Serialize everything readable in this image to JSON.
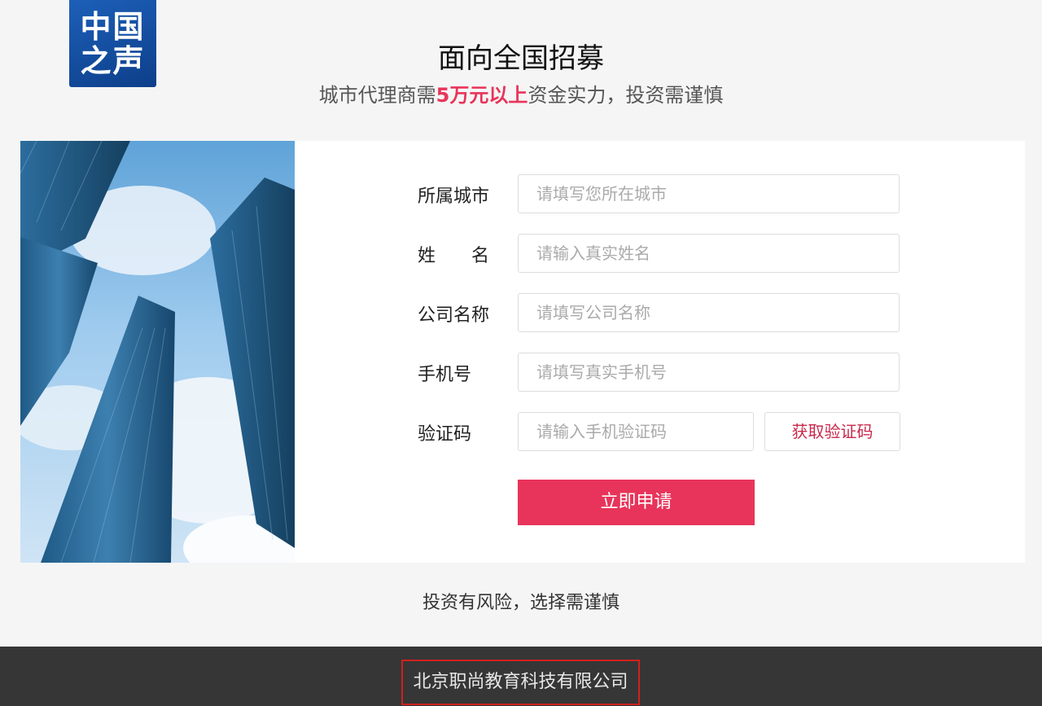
{
  "logo": {
    "line1": "中国",
    "line2": "之声"
  },
  "header": {
    "title": "面向全国招募",
    "subtitle_before": "城市代理商需",
    "subtitle_highlight": "5万元以上",
    "subtitle_after": "资金实力，投资需谨慎"
  },
  "form": {
    "city": {
      "label": "所属城市",
      "placeholder": "请填写您所在城市"
    },
    "name": {
      "label": "姓　　名",
      "placeholder": "请输入真实姓名"
    },
    "company": {
      "label": "公司名称",
      "placeholder": "请填写公司名称"
    },
    "phone": {
      "label": "手机号",
      "placeholder": "请填写真实手机号"
    },
    "code": {
      "label": "验证码",
      "placeholder": "请输入手机验证码",
      "button": "获取验证码"
    },
    "submit": "立即申请"
  },
  "notice": "投资有风险，选择需谨慎",
  "footer": {
    "company": "北京职尚教育科技有限公司"
  },
  "colors": {
    "accent": "#e8345a",
    "footer_bg": "#363636",
    "logo_bg": "#1d5fb8"
  },
  "image": "skyscrapers-photo"
}
